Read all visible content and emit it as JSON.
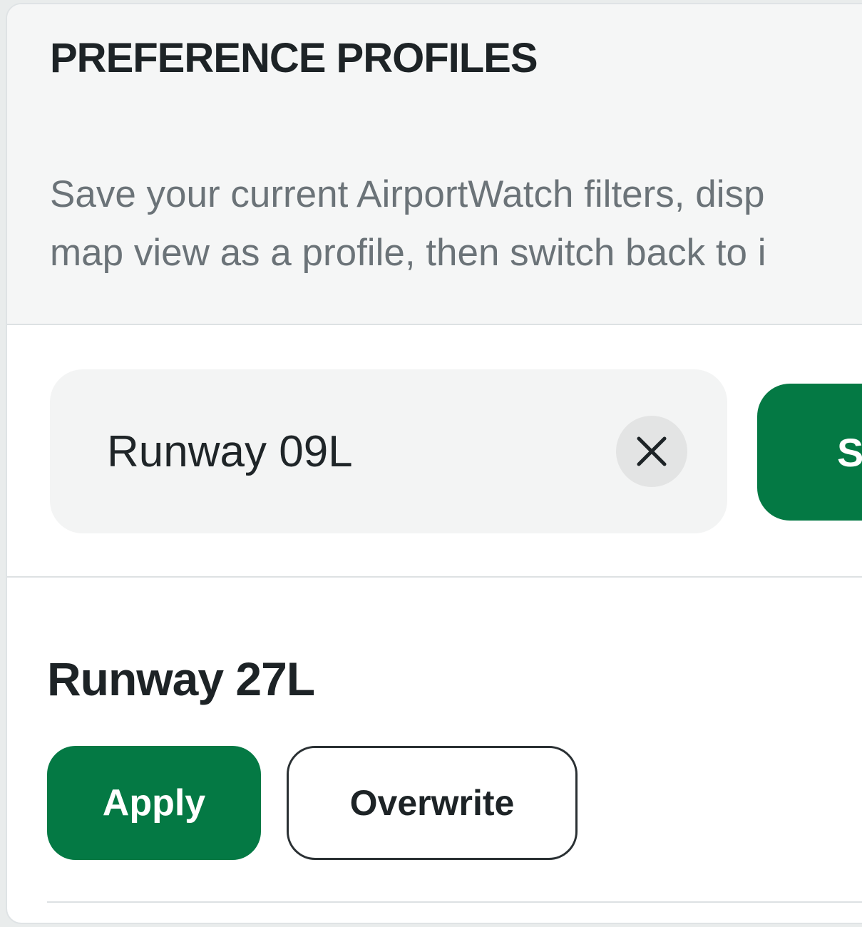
{
  "panel": {
    "title": "PREFERENCE PROFILES",
    "description_lines": [
      "Save your current AirportWatch filters, disp",
      "map view as a profile, then switch back to i"
    ]
  },
  "save_form": {
    "name_value": "Runway 09L",
    "clear_icon": "close-icon",
    "save_label": "S"
  },
  "profiles": [
    {
      "name": "Runway 27L",
      "apply_label": "Apply",
      "overwrite_label": "Overwrite"
    }
  ],
  "colors": {
    "accent": "#047944",
    "background": "#f5f6f6",
    "text": "#1d2326",
    "muted_text": "#6b7378"
  }
}
